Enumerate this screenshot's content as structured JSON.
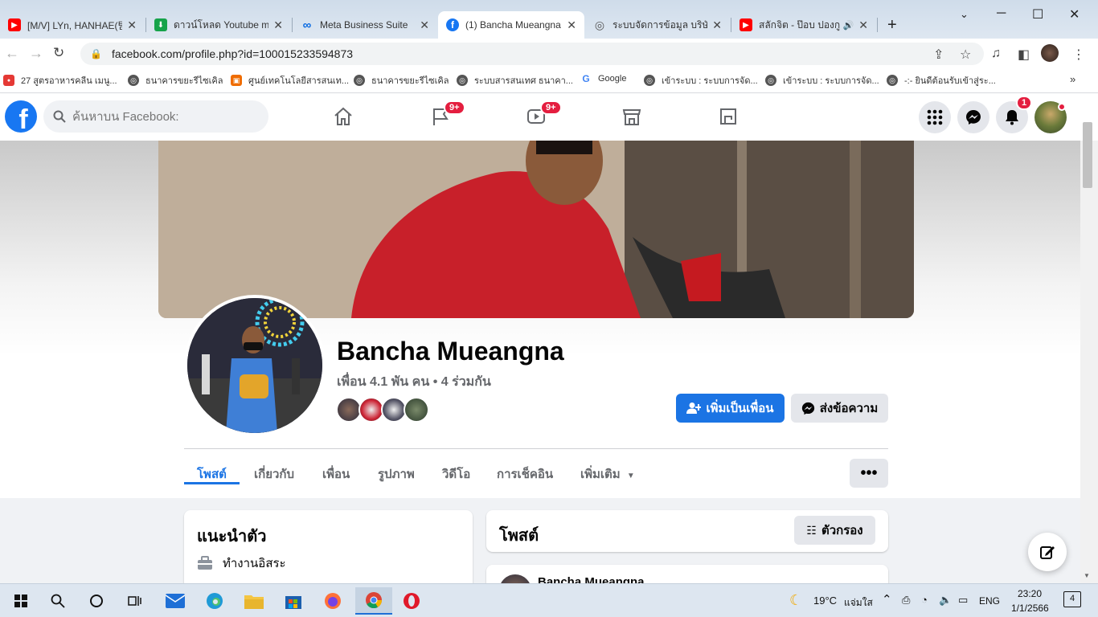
{
  "browser": {
    "tabs": [
      {
        "title": "[M/V] LYn, HANHAE(팀",
        "color": "#ff0000",
        "glyph": "▶"
      },
      {
        "title": "ดาวน์โหลด Youtube mp",
        "color": "#16a34a",
        "glyph": "⬇"
      },
      {
        "title": "Meta Business Suite",
        "color": "#0668e1",
        "glyph": "∞"
      },
      {
        "title": "(1) Bancha Mueangna",
        "color": "#1877f2",
        "glyph": "f"
      },
      {
        "title": "ระบบจัดการข้อมูล บริษัท",
        "color": "#555555",
        "glyph": "◎"
      },
      {
        "title": "สลักจิต - ป๊อบ ปองกู",
        "color": "#ff0000",
        "glyph": "▶"
      }
    ],
    "new_tab": "+",
    "url": "facebook.com/profile.php?id=100015233594873",
    "bookmarks": [
      "27 สูตรอาหารคลีน เมนู...",
      "ธนาคารขยะรีไซเคิล",
      "ศูนย์เทคโนโลยีสารสนเท...",
      "ธนาคารขยะรีไซเคิล",
      "ระบบสารสนเทศ ธนาคา...",
      "Google",
      "เข้าระบบ : ระบบการจัด...",
      "เข้าระบบ : ระบบการจัด...",
      "-:- ยินดีต้อนรับเข้าสู่ระ..."
    ],
    "bookmarks_more": "»"
  },
  "facebook": {
    "search_placeholder": "ค้นหาบน Facebook:",
    "badges": {
      "pages": "9+",
      "watch": "9+",
      "notifications": "1"
    },
    "profile": {
      "name": "Bancha Mueangna",
      "friends": "เพื่อน 4.1 พัน คน • 4 ร่วมกัน",
      "add_friend": "เพิ่มเป็นเพื่อน",
      "message": "ส่งข้อความ"
    },
    "tabs": [
      "โพสต์",
      "เกี่ยวกับ",
      "เพื่อน",
      "รูปภาพ",
      "วิดีโอ",
      "การเช็คอิน",
      "เพิ่มเติม"
    ],
    "more_menu": "•••",
    "intro": {
      "title": "แนะนำตัว",
      "work": "ทำงานอิสระ"
    },
    "posts": {
      "title": "โพสต์",
      "filter": "ตัวกรอง",
      "first_author": "Bancha Mueangna"
    }
  },
  "taskbar": {
    "weather_temp": "19°C",
    "weather_text": "แจ่มใส",
    "language": "ENG",
    "time": "23:20",
    "date": "1/1/2566",
    "notifications": "4"
  },
  "colors": {
    "fb_blue": "#1877f2",
    "badge_red": "#e41e3f"
  }
}
